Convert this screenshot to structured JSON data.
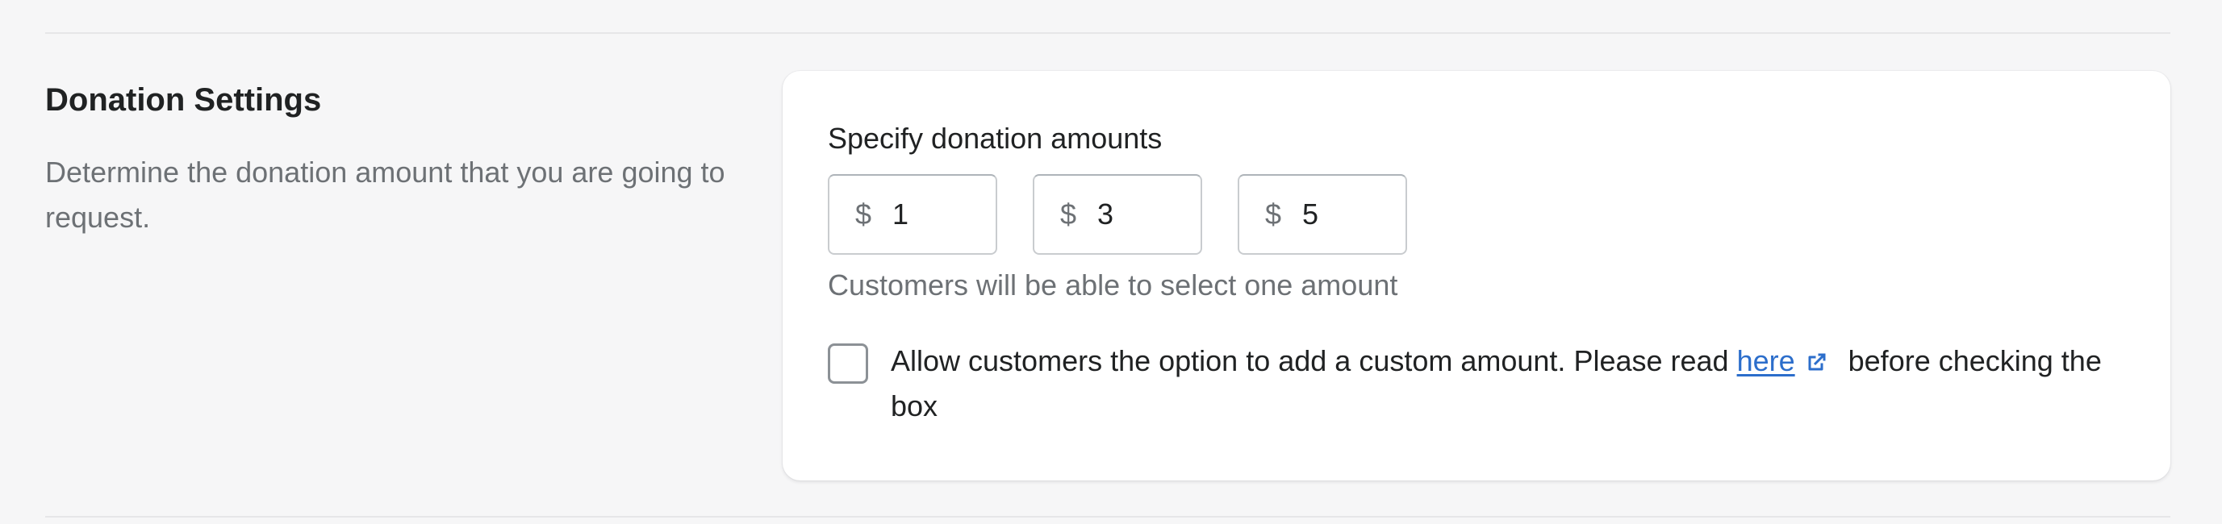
{
  "section": {
    "title": "Donation Settings",
    "description": "Determine the donation amount that you are going to request."
  },
  "card": {
    "label": "Specify donation amounts",
    "amounts": [
      {
        "prefix": "$",
        "value": "1"
      },
      {
        "prefix": "$",
        "value": "3"
      },
      {
        "prefix": "$",
        "value": "5"
      }
    ],
    "help_text": "Customers will be able to select one amount",
    "custom_amount": {
      "checked": false,
      "text_before": "Allow customers the option to add a custom amount. Please read ",
      "link_text": "here",
      "link_icon": "external-link-icon",
      "text_after": " before checking the box"
    }
  },
  "colors": {
    "background": "#f6f6f7",
    "card": "#ffffff",
    "link": "#2c6ecb",
    "subdued_text": "#6d7175"
  }
}
